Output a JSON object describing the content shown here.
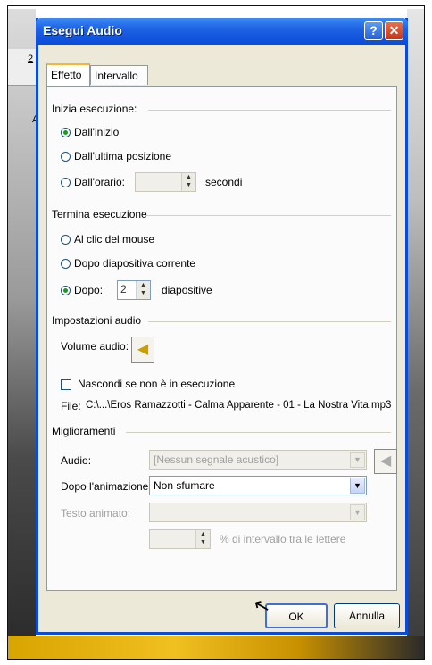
{
  "window": {
    "title": "Esegui Audio"
  },
  "tabs": [
    {
      "label": "Effetto"
    },
    {
      "label": "Intervallo"
    }
  ],
  "start": {
    "group_label": "Inizia esecuzione:",
    "option_start": "Dall'inizio",
    "option_last": "Dall'ultima posizione",
    "option_time": "Dall'orario:",
    "seconds_label": "secondi",
    "selected": "Dall'inizio"
  },
  "stop": {
    "group_label": "Termina esecuzione",
    "option_click": "Al clic del mouse",
    "option_after_slide": "Dopo diapositiva corrente",
    "option_after": "Dopo:",
    "after_value": "2",
    "slides_label": "diapositive",
    "selected": "Dopo:"
  },
  "audio_settings": {
    "group_label": "Impostazioni audio",
    "volume_label": "Volume audio:",
    "hide_label": "Nascondi se non è in esecuzione",
    "hide_checked": false,
    "file_label": "File:",
    "file_path": "C:\\...\\Eros Ramazzotti - Calma Apparente - 01 - La Nostra Vita.mp3"
  },
  "enhancements": {
    "group_label": "Miglioramenti",
    "audio_label": "Audio:",
    "audio_value": "[Nessun segnale acustico]",
    "after_anim_label": "Dopo l'animazione:",
    "after_anim_value": "Non sfumare",
    "anim_text_label": "Testo animato:",
    "anim_text_value": "",
    "interval_label": "% di intervallo tra le lettere"
  },
  "buttons": {
    "ok": "OK",
    "cancel": "Annulla"
  },
  "background": {
    "left_chars": [
      "2",
      "A"
    ]
  },
  "colors": {
    "titlebar": "#0a4bd8",
    "dialog_bg": "#ece9d8",
    "radio_dot": "#1a9c1a"
  }
}
